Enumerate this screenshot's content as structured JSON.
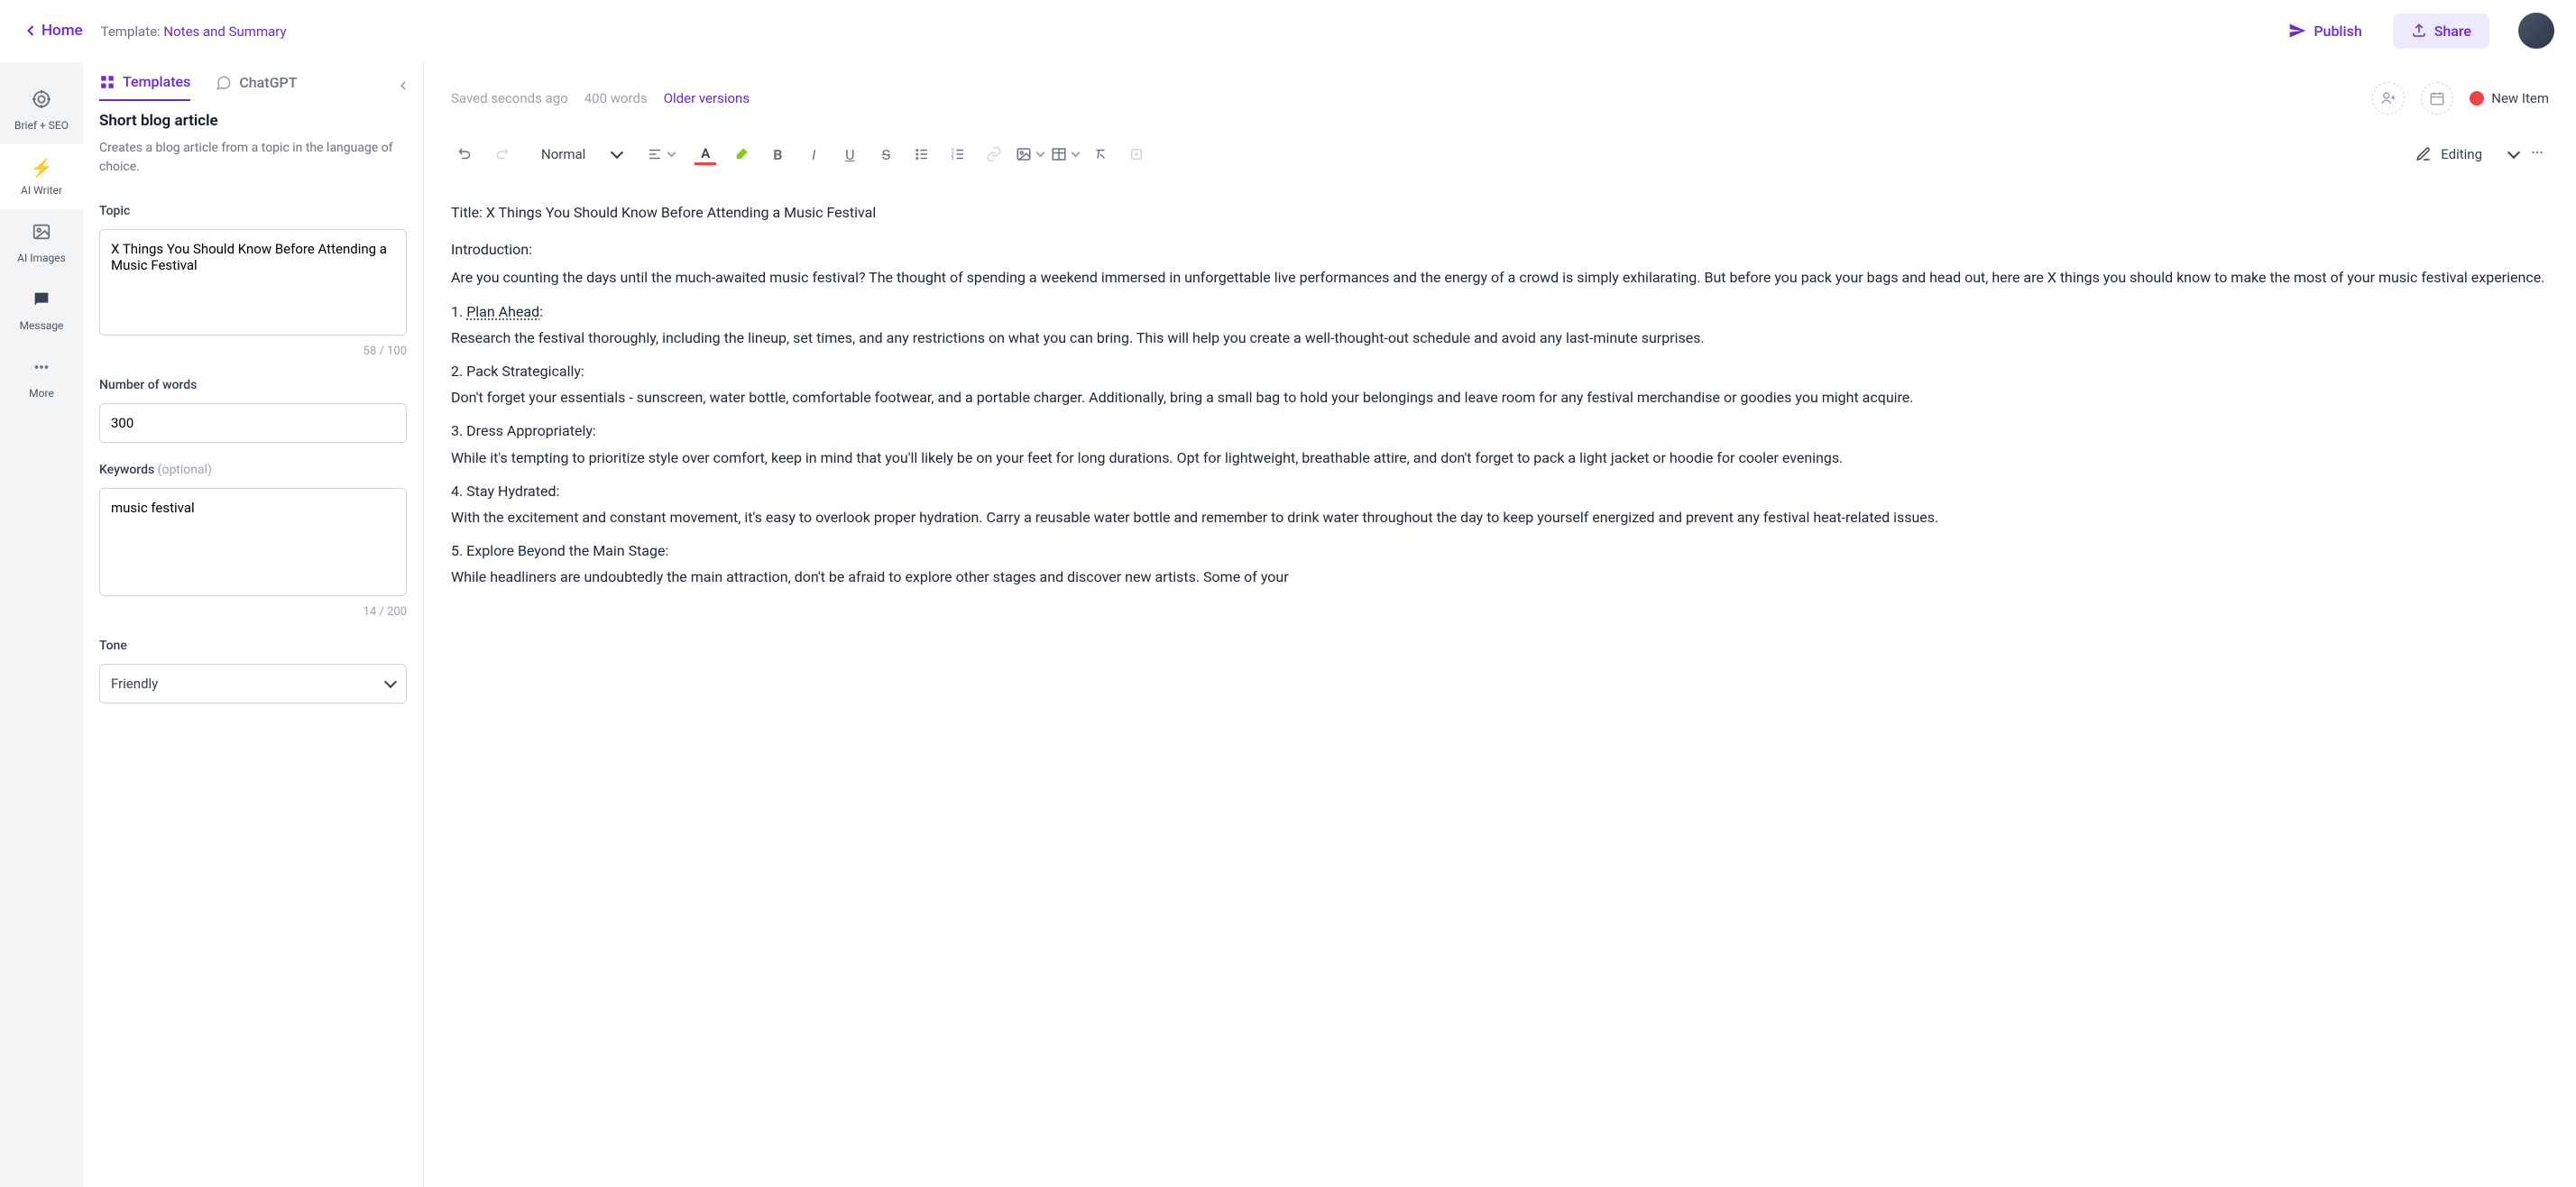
{
  "header": {
    "home": "Home",
    "template_label": "Template: ",
    "template_name": "Notes and Summary",
    "publish": "Publish",
    "share": "Share"
  },
  "sidebar": {
    "items": [
      {
        "label": "Brief + SEO"
      },
      {
        "label": "AI Writer"
      },
      {
        "label": "AI Images"
      },
      {
        "label": "Message"
      },
      {
        "label": "More"
      }
    ]
  },
  "tabs": {
    "templates": "Templates",
    "chatgpt": "ChatGPT"
  },
  "panel": {
    "title": "Short blog article",
    "desc": "Creates a blog article from a topic in the language of choice.",
    "topic_label": "Topic",
    "topic_value": "X Things You Should Know Before Attending a Music Festival",
    "topic_count": "58 / 100",
    "words_label": "Number of words",
    "words_value": "300",
    "keywords_label": "Keywords ",
    "keywords_optional": "(optional)",
    "keywords_value": "music festival",
    "keywords_count": "14 / 200",
    "tone_label": "Tone",
    "tone_value": "Friendly"
  },
  "editor": {
    "saved": "Saved seconds ago",
    "words": "400 words",
    "versions": "Older versions",
    "new_item": "New Item",
    "style": "Normal",
    "editing": "Editing"
  },
  "document": {
    "title": "Title: X Things You Should Know Before Attending a Music Festival",
    "intro_label": "Introduction:",
    "intro_text": "Are you counting the days until the much-awaited music festival? The thought of spending a weekend immersed in unforgettable live performances and the energy of a crowd is simply exhilarating. But before you pack your bags and head out, here are X things you should know to make the most of your music festival experience.",
    "s1_num": "1. ",
    "s1_title": "Plan Ahead",
    "s1_colon": ":",
    "s1_text": "Research the festival thoroughly, including the lineup, set times, and any restrictions on what you can bring. This will help you create a well-thought-out schedule and avoid any last-minute surprises.",
    "s2_title": "2. Pack Strategically:",
    "s2_text": "Don't forget your essentials - sunscreen, water bottle, comfortable footwear, and a portable charger. Additionally, bring a small bag to hold your belongings and leave room for any festival merchandise or goodies you might acquire.",
    "s3_title": "3. Dress Appropriately:",
    "s3_text": "While it's tempting to prioritize style over comfort, keep in mind that you'll likely be on your feet for long durations. Opt for lightweight, breathable attire, and don't forget to pack a light jacket or hoodie for cooler evenings.",
    "s4_title": "4. Stay Hydrated:",
    "s4_text": "With the excitement and constant movement, it's easy to overlook proper hydration. Carry a reusable water bottle and remember to drink water throughout the day to keep yourself energized and prevent any festival heat-related issues.",
    "s5_title": "5. Explore Beyond the Main Stage:",
    "s5_text": "While headliners are undoubtedly the main attraction, don't be afraid to explore other stages and discover new artists. Some of your"
  }
}
